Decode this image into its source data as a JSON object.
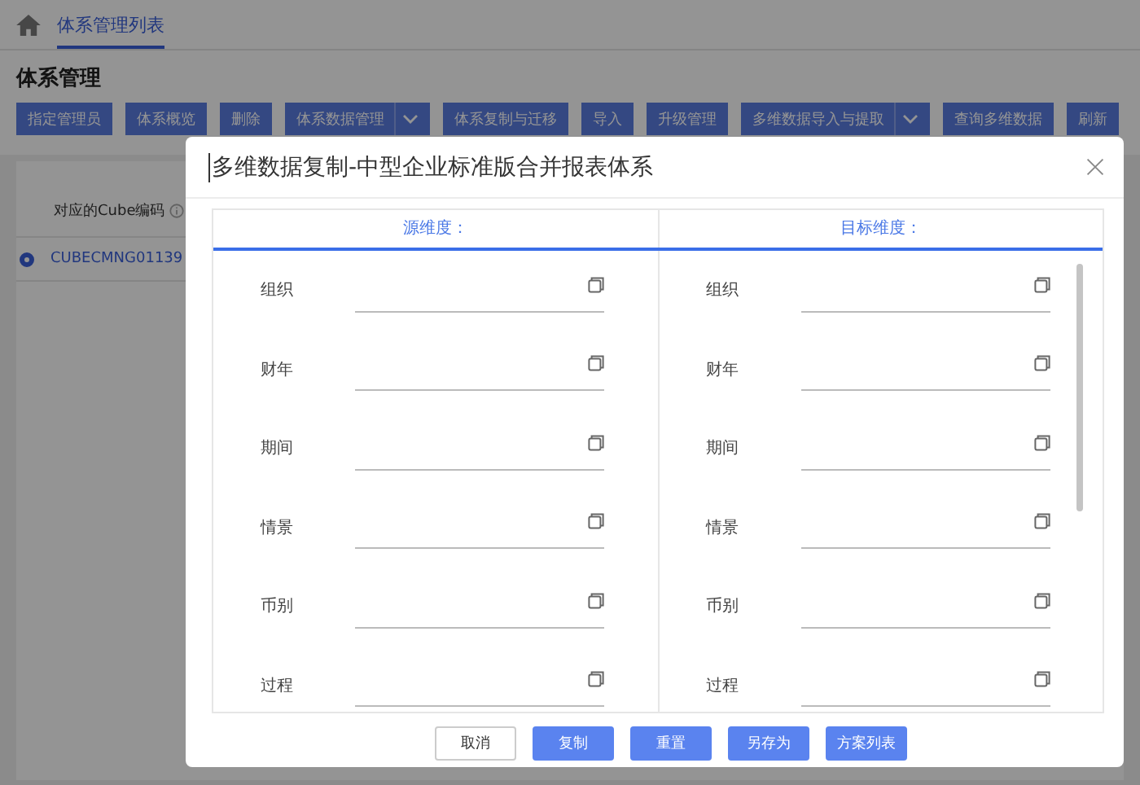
{
  "breadcrumb": {
    "tabs": [
      {
        "label": "体系管理列表",
        "selected": true
      }
    ]
  },
  "page_title": "体系管理",
  "toolbar": [
    {
      "label": "指定管理员",
      "dropdown": false
    },
    {
      "label": "体系概览",
      "dropdown": false
    },
    {
      "label": "删除",
      "dropdown": false
    },
    {
      "label": "体系数据管理",
      "dropdown": true
    },
    {
      "label": "体系复制与迁移",
      "dropdown": false
    },
    {
      "label": "导入",
      "dropdown": false
    },
    {
      "label": "升级管理",
      "dropdown": false
    },
    {
      "label": "多维数据导入与提取",
      "dropdown": true
    },
    {
      "label": "查询多维数据",
      "dropdown": false
    },
    {
      "label": "刷新",
      "dropdown": false
    }
  ],
  "table": {
    "columns": [
      "对应的Cube编码"
    ],
    "rows": [
      {
        "selected": true,
        "cells": [
          "CUBECMNG01139"
        ]
      }
    ]
  },
  "dialog": {
    "title": "多维数据复制-中型企业标准版合并报表体系",
    "columns": [
      {
        "heading": "源维度：",
        "fields": [
          {
            "label": "组织"
          },
          {
            "label": "财年"
          },
          {
            "label": "期间"
          },
          {
            "label": "情景"
          },
          {
            "label": "币别"
          },
          {
            "label": "过程"
          }
        ]
      },
      {
        "heading": "目标维度：",
        "fields": [
          {
            "label": "组织"
          },
          {
            "label": "财年"
          },
          {
            "label": "期间"
          },
          {
            "label": "情景"
          },
          {
            "label": "币别"
          },
          {
            "label": "过程"
          }
        ]
      }
    ],
    "buttons": [
      {
        "label": "取消",
        "primary": false
      },
      {
        "label": "复制",
        "primary": true
      },
      {
        "label": "重置",
        "primary": true
      },
      {
        "label": "另存为",
        "primary": true
      },
      {
        "label": "方案列表",
        "primary": true
      }
    ]
  }
}
